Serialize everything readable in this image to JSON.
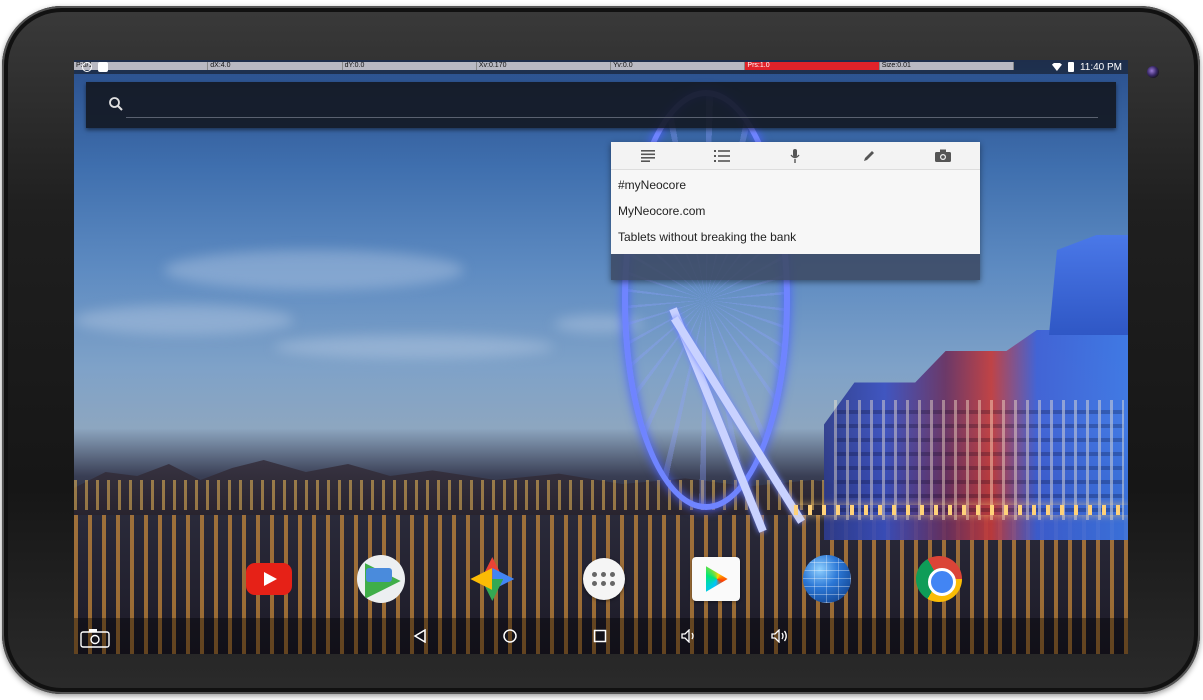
{
  "status_bar": {
    "debug": {
      "p": "P:0/1",
      "dx": "dX:4.0",
      "dy": "dY:0.0",
      "xv": "Xv:0.170",
      "yv": "Yv:0.0",
      "prs": "Prs:1.0",
      "size": "Size:0.01"
    },
    "time": "11:40 PM",
    "icons": [
      "clock-icon",
      "clipboard-icon",
      "wifi-icon",
      "battery-icon"
    ]
  },
  "search": {
    "value": "",
    "placeholder": "",
    "icon": "search-icon"
  },
  "keep_widget": {
    "toolbar": [
      "text-note-icon",
      "checklist-icon",
      "microphone-icon",
      "pen-icon",
      "camera-icon"
    ],
    "notes": [
      "#myNeocore",
      "MyNeocore.com",
      "Tablets without breaking the bank"
    ]
  },
  "dock": {
    "apps": [
      "youtube-icon",
      "play-games-icon",
      "photos-icon",
      "app-drawer-icon",
      "play-store-icon",
      "browser-icon",
      "chrome-icon"
    ]
  },
  "nav": {
    "buttons": [
      "screenshot-icon",
      "back-icon",
      "home-icon",
      "recents-icon",
      "volume-down-icon",
      "volume-up-icon"
    ]
  },
  "colors": {
    "debug_bar": "#b9b9c2",
    "debug_highlight": "#e0222a",
    "widget_bg": "#f7f7f7",
    "youtube_red": "#e62117"
  }
}
